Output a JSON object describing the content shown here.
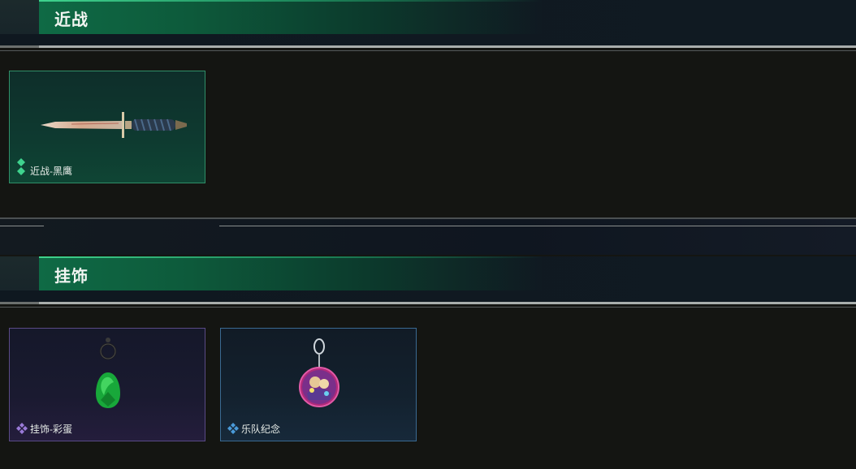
{
  "sections": [
    {
      "title": "近战",
      "items": [
        {
          "label": "近战-黑鹰",
          "rarity": "green",
          "icon": "knife-icon",
          "accent": "#2f8f68"
        }
      ]
    },
    {
      "title": "挂饰",
      "items": [
        {
          "label": "挂饰-彩蛋",
          "rarity": "purple",
          "icon": "egg-charm-icon",
          "accent": "#5a4a86"
        },
        {
          "label": "乐队纪念",
          "rarity": "blue",
          "icon": "badge-charm-icon",
          "accent": "#3a6a92"
        }
      ]
    }
  ]
}
